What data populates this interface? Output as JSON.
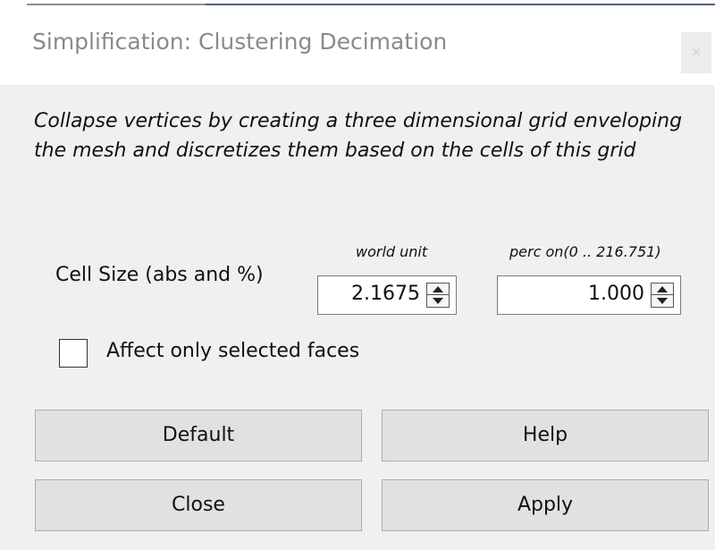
{
  "window": {
    "title": "Simplification: Clustering Decimation",
    "close_glyph": "×"
  },
  "description": "Collapse vertices by creating a three dimensional grid enveloping the mesh and discretizes them based on the cells of this grid",
  "cell_size": {
    "label": "Cell Size (abs and %)",
    "abs_unit_label": "world unit",
    "perc_unit_label": "perc on(0 .. 216.751)",
    "abs_value": "2.1675",
    "perc_value": "1.000"
  },
  "affect_selected": {
    "label": "Affect only selected faces",
    "checked": false
  },
  "buttons": {
    "default": "Default",
    "help": "Help",
    "close": "Close",
    "apply": "Apply"
  },
  "icons": {
    "spin_up": "up-arrow-icon",
    "spin_down": "down-arrow-icon"
  }
}
